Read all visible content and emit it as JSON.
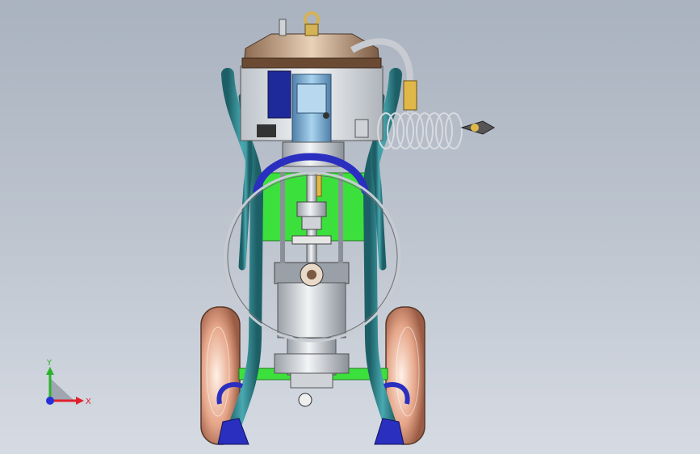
{
  "viewport": {
    "background_top": "#a9b2bf",
    "background_bottom": "#d6dbe3"
  },
  "triad": {
    "x_label": "X",
    "y_label": "Y",
    "x_color": "#e0202a",
    "y_color": "#2bb32b",
    "z_color": "#2530d8"
  },
  "model": {
    "frame_color": "#2f7f86",
    "base_plate_color": "#3ce03c",
    "wheel_color": "#e6a68a",
    "handle_color": "#2a2fbf",
    "hose_color": "#c8ccd2"
  }
}
